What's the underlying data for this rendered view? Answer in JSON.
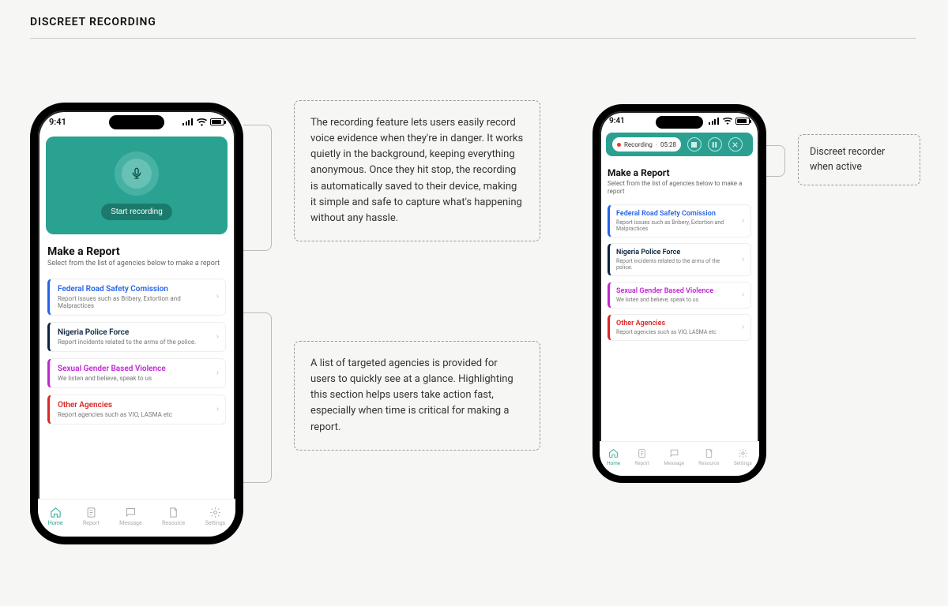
{
  "section_title": "DISCREET RECORDING",
  "callouts": {
    "recording": "The recording feature lets users easily record voice evidence when they're in danger. It works quietly in the background, keeping everything anonymous. Once they hit stop, the recording is automatically saved to their device, making it simple and safe to capture what's happening without any hassle.",
    "agencies": "A list of targeted agencies is provided for users to quickly see at a glance. Highlighting this section helps users take action fast, especially when time is critical for making a report.",
    "active": "Discreet recorder when active"
  },
  "status": {
    "time": "9:41"
  },
  "start_recording_label": "Start recording",
  "recording_bar": {
    "label": "Recording",
    "time": "05:28"
  },
  "report": {
    "title": "Make a Report",
    "subtitle": "Select from the list of agencies below to make a report"
  },
  "agencies": [
    {
      "name": "Federal Road Safety Comission",
      "desc": "Report issues such as Bribery, Extortion and Malpractices",
      "color": "#2563eb"
    },
    {
      "name": "Nigeria Police Force",
      "desc": "Report incidents related to the arms of the police.",
      "color": "#0b2340"
    },
    {
      "name": "Sexual Gender Based Violence",
      "desc": "We listen and believe, speak to us",
      "color": "#c026d3"
    },
    {
      "name": "Other Agencies",
      "desc": "Report agencies such as VIO, LASMA etc",
      "color": "#dc2626"
    }
  ],
  "nav": [
    {
      "label": "Home",
      "active": true
    },
    {
      "label": "Report",
      "active": false
    },
    {
      "label": "Message",
      "active": false
    },
    {
      "label": "Resource",
      "active": false
    },
    {
      "label": "Settings",
      "active": false
    }
  ]
}
